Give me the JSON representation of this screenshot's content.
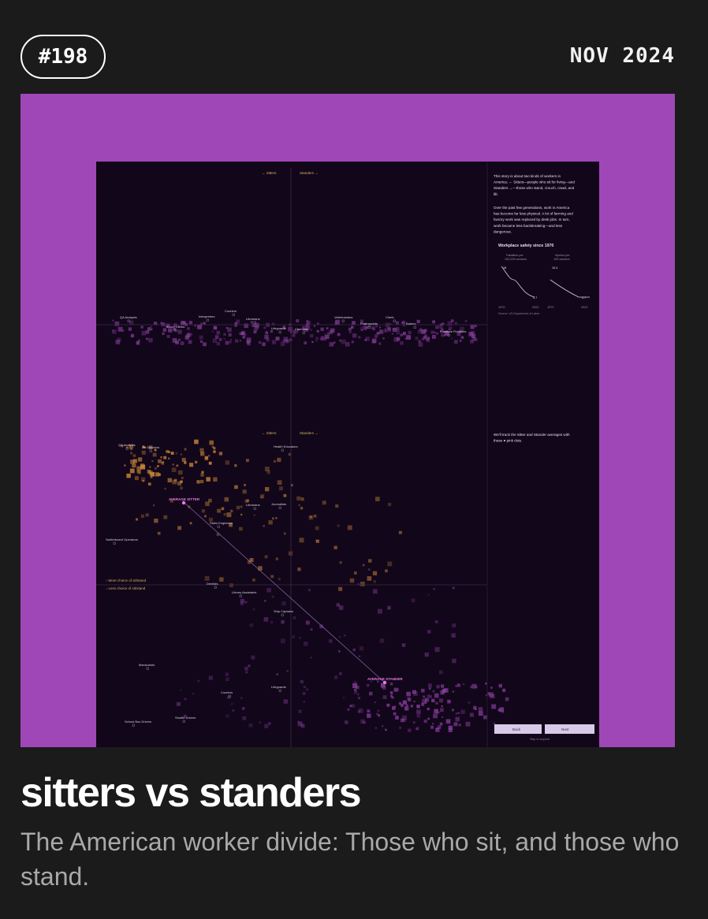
{
  "card": {
    "number": "#198",
    "date": "NOV 2024",
    "title": "sitters vs standers",
    "description": "The American worker divide: Those who sit, and those who stand."
  },
  "preview": {
    "labels": {
      "sitters_arrow": "← Sitters",
      "standers_arrow": "Standers →",
      "more_choice": "↑ More choice of sit/stand",
      "less_choice": "↓ Less choice of sit/stand",
      "average_sitter": "AVERAGE SITTER",
      "average_stander": "AVERAGE STANDER"
    },
    "top_occupations": [
      "QA Analysts",
      "Court Clerks",
      "Interpreters",
      "Couriers",
      "Librarians",
      "Lifeguards",
      "Chemists",
      "Veterinarians",
      "Pharmacists",
      "Chefs",
      "Bakers",
      "Furniture Finishers"
    ],
    "mid_occupations": [
      "QA Analysts",
      "Art Directors",
      "Health Educators",
      "Journalists",
      "Librarians",
      "Sales Engineers",
      "Switchboard Operators"
    ],
    "low_occupations": [
      "Dentists",
      "Library Assistants",
      "Ship Captains",
      "Manicurists",
      "Couriers",
      "Lifeguards",
      "School Bus Drivers",
      "Shuttle Drivers"
    ],
    "sidebar": {
      "intro": [
        "This story is about two kinds of workers in",
        "America: ← Sitters—people who sit for living—and",
        "Standers →—those who stand, crouch, crawl, and",
        "lift."
      ],
      "para2": [
        "Over the past few generations, work in America",
        "has become far less physical. A lot of farming and",
        "factory work was replaced by desk jobs. In turn,",
        "work became less backbreaking—and less",
        "dangerous."
      ],
      "chart_title": "Workplace safety since 1970",
      "track_note": [
        "We'll track the Sitter and Stander averages with",
        "these ● pink dots."
      ],
      "back_label": "Back",
      "next_label": "Next",
      "skip_label": "Skip to explore"
    },
    "mini_charts": [
      {
        "label_l1": "Fatalities per",
        "label_l2": "100,000 workers",
        "start": "18",
        "end": "3.7",
        "x_start": "1970",
        "x_end": "2022"
      },
      {
        "label_l1": "Injuries per",
        "label_l2": "100 workers",
        "start": "10.4",
        "end": "2.7",
        "x_start": "1970",
        "x_end": "2022"
      }
    ],
    "source": "Source: US Department of Labor",
    "colors": {
      "hero_bg": "#a047b8",
      "dot_sitter": "#c9873a",
      "dot_stander": "#8a3fa0",
      "pink": "#e57be6"
    }
  }
}
